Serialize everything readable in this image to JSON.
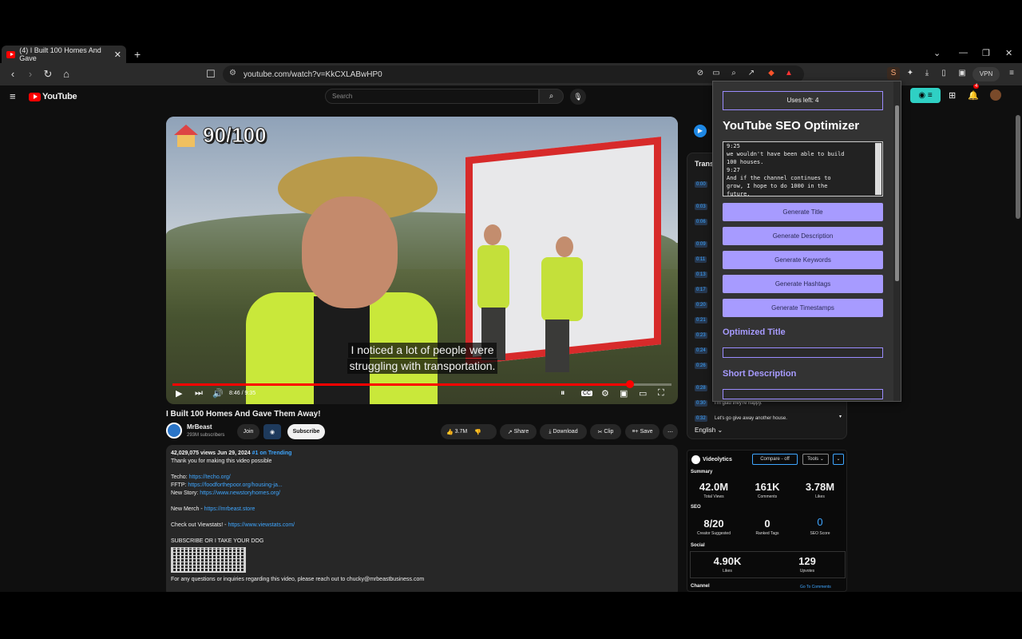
{
  "browser": {
    "tab_title": "(4) I Built 100 Homes And Gave",
    "tab_close": "✕",
    "new_tab": "+",
    "url": "youtube.com/watch?v=KkCXLABwHP0",
    "vpn_label": "VPN",
    "ext_badge": "S"
  },
  "youtube": {
    "logo_text": "YouTube",
    "search_placeholder": "Search",
    "notification_count": "4"
  },
  "video": {
    "overlay_score": "90/100",
    "caption_line1": "I noticed a lot of people were",
    "caption_line2": "struggling with transportation.",
    "time": "8:46 / 9:35",
    "progress_fraction": 0.916,
    "title": "I Built 100 Homes And Gave Them Away!"
  },
  "channel": {
    "name": "MrBeast",
    "subscribers": "293M subscribers",
    "join": "Join",
    "subscribe": "Subscribe",
    "likes": "3.7M",
    "share": "Share",
    "download": "Download",
    "clip": "Clip",
    "save": "Save",
    "more": "⋯"
  },
  "description": {
    "stats": "42,029,075 views  Jun 29, 2024",
    "trending": "#1 on Trending",
    "line1": "Thank you for making this video possible",
    "techo_label": "Techo: ",
    "techo_link": "https://techo.org/",
    "fftp_label": "FFTP: ",
    "fftp_link": "https://foodforthepoor.org/housing-ja...",
    "newstory_label": "New Story: ",
    "newstory_link": "https://www.newstoryhomes.org/",
    "merch_label": "New Merch - ",
    "merch_link": "https://mrbeast.store",
    "viewstats_label": "Check out Viewstats! - ",
    "viewstats_link": "https://www.viewstats.com/",
    "subscribe_line": "SUBSCRIBE OR I TAKE YOUR DOG",
    "contact_line": "For any questions or inquiries regarding this video, please reach out to chucky@mrbeastbusiness.com"
  },
  "transcript": {
    "title": "Trans",
    "stamps": [
      "0:00",
      "0:03",
      "0:06",
      "0:09",
      "0:11",
      "0:13",
      "0:17",
      "0:20",
      "0:21",
      "0:23",
      "0:24",
      "0:26",
      "0:28",
      "0:30",
      "0:32"
    ],
    "line_happy": "I'm glad they're happy.",
    "line_next": "Let's go give away another house.",
    "language": "English"
  },
  "videolytics": {
    "brand": "Videolytics",
    "compare": "Compare - off",
    "tools": "Tools",
    "summary_label": "Summary",
    "views": "42.0M",
    "views_label": "Total Views",
    "comments": "161K",
    "comments_label": "Comments",
    "likes": "3.78M",
    "likes_label": "Likes",
    "seo_label": "SEO",
    "creator_tags": "8/20",
    "creator_tags_label": "Creator Suggested",
    "ranked_tags": "0",
    "ranked_tags_label": "Ranked Tags",
    "seo_score": "0",
    "seo_score_label": "SEO Score",
    "social_label": "Social",
    "social_likes": "4.90K",
    "social_likes_label": "Likes",
    "upvotes": "129",
    "upvotes_label": "Upvotes",
    "channel_label": "Channel",
    "go_comments": "Go To Comments"
  },
  "seo_popup": {
    "uses_left": "Uses left: 4",
    "title": "YouTube SEO Optimizer",
    "transcript_text": "9:25\nwe wouldn't have been able to build\n100 houses.\n9:27\nAnd if the channel continues to\ngrow, I hope to do 1000 in the\nfuture.",
    "btn_title": "Generate Title",
    "btn_description": "Generate Description",
    "btn_keywords": "Generate Keywords",
    "btn_hashtags": "Generate Hashtags",
    "btn_timestamps": "Generate Timestamps",
    "optimized_title_label": "Optimized Title",
    "short_description_label": "Short Description"
  },
  "colors": {
    "accent": "#a79bff",
    "youtube_red": "#ff0000",
    "link": "#3ea6ff"
  }
}
